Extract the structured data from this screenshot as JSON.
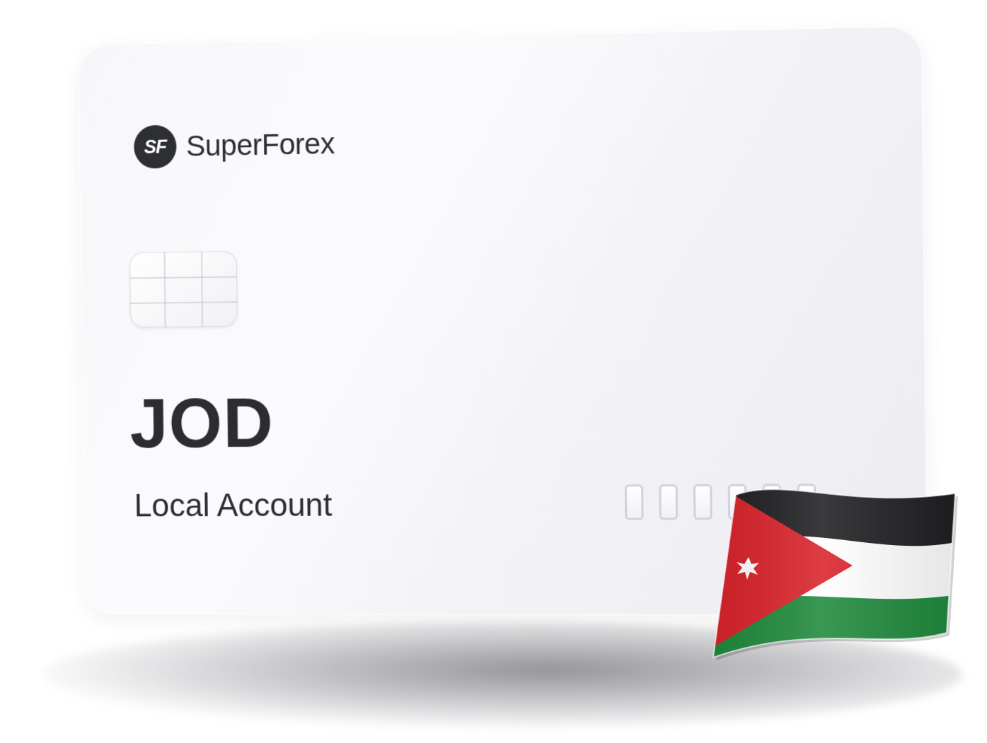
{
  "card": {
    "brand_logo_text": "SF",
    "brand_name": "SuperForex",
    "currency_code": "JOD",
    "account_type": "Local Account",
    "digit_count": 6
  },
  "flag": {
    "country": "Jordan",
    "icon": "jordan-flag-icon",
    "colors": {
      "top_stripe": "#1f1f22",
      "middle_stripe": "#ffffff",
      "bottom_stripe": "#1e8a3c",
      "triangle": "#d9222a",
      "star": "#ffffff"
    }
  }
}
